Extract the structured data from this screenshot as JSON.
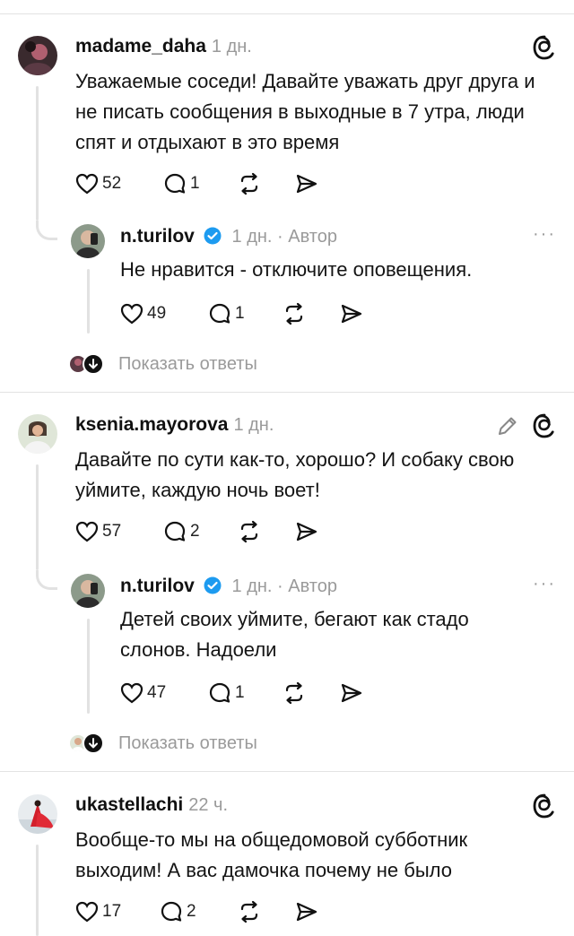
{
  "colors": {
    "accent_verified": "#1d9bf0",
    "muted": "#9a9a9a",
    "rail": "#e2e2e2"
  },
  "threads": [
    {
      "username": "madame_daha",
      "time": "1 дн.",
      "text": "Уважаемые соседи! Давайте уважать друг друга и не писать сообщения в выходные в 7 утра, люди спят и отдыхают в это время",
      "likes": "52",
      "comments": "1",
      "reply": {
        "username": "n.turilov",
        "time": "1 дн. · Автор",
        "text": "Не нравится - отключите оповещения.",
        "likes": "49",
        "comments": "1",
        "more": "···"
      },
      "show_replies": "Показать ответы"
    },
    {
      "username": "ksenia.mayorova",
      "time": "1 дн.",
      "text": "Давайте по сути как-то, хорошо? И собаку свою уймите, каждую ночь воет!",
      "likes": "57",
      "comments": "2",
      "reply": {
        "username": "n.turilov",
        "time": "1 дн. · Автор",
        "text": "Детей своих уймите, бегают как стадо слонов. Надоели",
        "likes": "47",
        "comments": "1",
        "more": "···"
      },
      "show_replies": "Показать ответы"
    },
    {
      "username": "ukastellachi",
      "time": "22 ч.",
      "text": "Вообще-то мы на общедомовой субботник выходим! А вас дамочка почему не было",
      "likes": "17",
      "comments": "2"
    }
  ]
}
